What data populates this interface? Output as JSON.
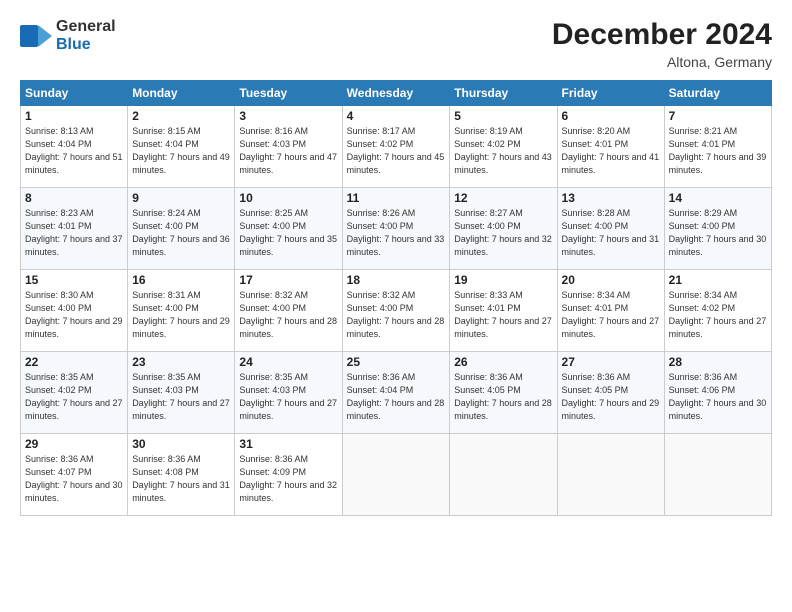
{
  "header": {
    "logo_line1": "General",
    "logo_line2": "Blue",
    "month": "December 2024",
    "location": "Altona, Germany"
  },
  "weekdays": [
    "Sunday",
    "Monday",
    "Tuesday",
    "Wednesday",
    "Thursday",
    "Friday",
    "Saturday"
  ],
  "weeks": [
    [
      {
        "day": "1",
        "sunrise": "Sunrise: 8:13 AM",
        "sunset": "Sunset: 4:04 PM",
        "daylight": "Daylight: 7 hours and 51 minutes."
      },
      {
        "day": "2",
        "sunrise": "Sunrise: 8:15 AM",
        "sunset": "Sunset: 4:04 PM",
        "daylight": "Daylight: 7 hours and 49 minutes."
      },
      {
        "day": "3",
        "sunrise": "Sunrise: 8:16 AM",
        "sunset": "Sunset: 4:03 PM",
        "daylight": "Daylight: 7 hours and 47 minutes."
      },
      {
        "day": "4",
        "sunrise": "Sunrise: 8:17 AM",
        "sunset": "Sunset: 4:02 PM",
        "daylight": "Daylight: 7 hours and 45 minutes."
      },
      {
        "day": "5",
        "sunrise": "Sunrise: 8:19 AM",
        "sunset": "Sunset: 4:02 PM",
        "daylight": "Daylight: 7 hours and 43 minutes."
      },
      {
        "day": "6",
        "sunrise": "Sunrise: 8:20 AM",
        "sunset": "Sunset: 4:01 PM",
        "daylight": "Daylight: 7 hours and 41 minutes."
      },
      {
        "day": "7",
        "sunrise": "Sunrise: 8:21 AM",
        "sunset": "Sunset: 4:01 PM",
        "daylight": "Daylight: 7 hours and 39 minutes."
      }
    ],
    [
      {
        "day": "8",
        "sunrise": "Sunrise: 8:23 AM",
        "sunset": "Sunset: 4:01 PM",
        "daylight": "Daylight: 7 hours and 37 minutes."
      },
      {
        "day": "9",
        "sunrise": "Sunrise: 8:24 AM",
        "sunset": "Sunset: 4:00 PM",
        "daylight": "Daylight: 7 hours and 36 minutes."
      },
      {
        "day": "10",
        "sunrise": "Sunrise: 8:25 AM",
        "sunset": "Sunset: 4:00 PM",
        "daylight": "Daylight: 7 hours and 35 minutes."
      },
      {
        "day": "11",
        "sunrise": "Sunrise: 8:26 AM",
        "sunset": "Sunset: 4:00 PM",
        "daylight": "Daylight: 7 hours and 33 minutes."
      },
      {
        "day": "12",
        "sunrise": "Sunrise: 8:27 AM",
        "sunset": "Sunset: 4:00 PM",
        "daylight": "Daylight: 7 hours and 32 minutes."
      },
      {
        "day": "13",
        "sunrise": "Sunrise: 8:28 AM",
        "sunset": "Sunset: 4:00 PM",
        "daylight": "Daylight: 7 hours and 31 minutes."
      },
      {
        "day": "14",
        "sunrise": "Sunrise: 8:29 AM",
        "sunset": "Sunset: 4:00 PM",
        "daylight": "Daylight: 7 hours and 30 minutes."
      }
    ],
    [
      {
        "day": "15",
        "sunrise": "Sunrise: 8:30 AM",
        "sunset": "Sunset: 4:00 PM",
        "daylight": "Daylight: 7 hours and 29 minutes."
      },
      {
        "day": "16",
        "sunrise": "Sunrise: 8:31 AM",
        "sunset": "Sunset: 4:00 PM",
        "daylight": "Daylight: 7 hours and 29 minutes."
      },
      {
        "day": "17",
        "sunrise": "Sunrise: 8:32 AM",
        "sunset": "Sunset: 4:00 PM",
        "daylight": "Daylight: 7 hours and 28 minutes."
      },
      {
        "day": "18",
        "sunrise": "Sunrise: 8:32 AM",
        "sunset": "Sunset: 4:00 PM",
        "daylight": "Daylight: 7 hours and 28 minutes."
      },
      {
        "day": "19",
        "sunrise": "Sunrise: 8:33 AM",
        "sunset": "Sunset: 4:01 PM",
        "daylight": "Daylight: 7 hours and 27 minutes."
      },
      {
        "day": "20",
        "sunrise": "Sunrise: 8:34 AM",
        "sunset": "Sunset: 4:01 PM",
        "daylight": "Daylight: 7 hours and 27 minutes."
      },
      {
        "day": "21",
        "sunrise": "Sunrise: 8:34 AM",
        "sunset": "Sunset: 4:02 PM",
        "daylight": "Daylight: 7 hours and 27 minutes."
      }
    ],
    [
      {
        "day": "22",
        "sunrise": "Sunrise: 8:35 AM",
        "sunset": "Sunset: 4:02 PM",
        "daylight": "Daylight: 7 hours and 27 minutes."
      },
      {
        "day": "23",
        "sunrise": "Sunrise: 8:35 AM",
        "sunset": "Sunset: 4:03 PM",
        "daylight": "Daylight: 7 hours and 27 minutes."
      },
      {
        "day": "24",
        "sunrise": "Sunrise: 8:35 AM",
        "sunset": "Sunset: 4:03 PM",
        "daylight": "Daylight: 7 hours and 27 minutes."
      },
      {
        "day": "25",
        "sunrise": "Sunrise: 8:36 AM",
        "sunset": "Sunset: 4:04 PM",
        "daylight": "Daylight: 7 hours and 28 minutes."
      },
      {
        "day": "26",
        "sunrise": "Sunrise: 8:36 AM",
        "sunset": "Sunset: 4:05 PM",
        "daylight": "Daylight: 7 hours and 28 minutes."
      },
      {
        "day": "27",
        "sunrise": "Sunrise: 8:36 AM",
        "sunset": "Sunset: 4:05 PM",
        "daylight": "Daylight: 7 hours and 29 minutes."
      },
      {
        "day": "28",
        "sunrise": "Sunrise: 8:36 AM",
        "sunset": "Sunset: 4:06 PM",
        "daylight": "Daylight: 7 hours and 30 minutes."
      }
    ],
    [
      {
        "day": "29",
        "sunrise": "Sunrise: 8:36 AM",
        "sunset": "Sunset: 4:07 PM",
        "daylight": "Daylight: 7 hours and 30 minutes."
      },
      {
        "day": "30",
        "sunrise": "Sunrise: 8:36 AM",
        "sunset": "Sunset: 4:08 PM",
        "daylight": "Daylight: 7 hours and 31 minutes."
      },
      {
        "day": "31",
        "sunrise": "Sunrise: 8:36 AM",
        "sunset": "Sunset: 4:09 PM",
        "daylight": "Daylight: 7 hours and 32 minutes."
      },
      null,
      null,
      null,
      null
    ]
  ]
}
